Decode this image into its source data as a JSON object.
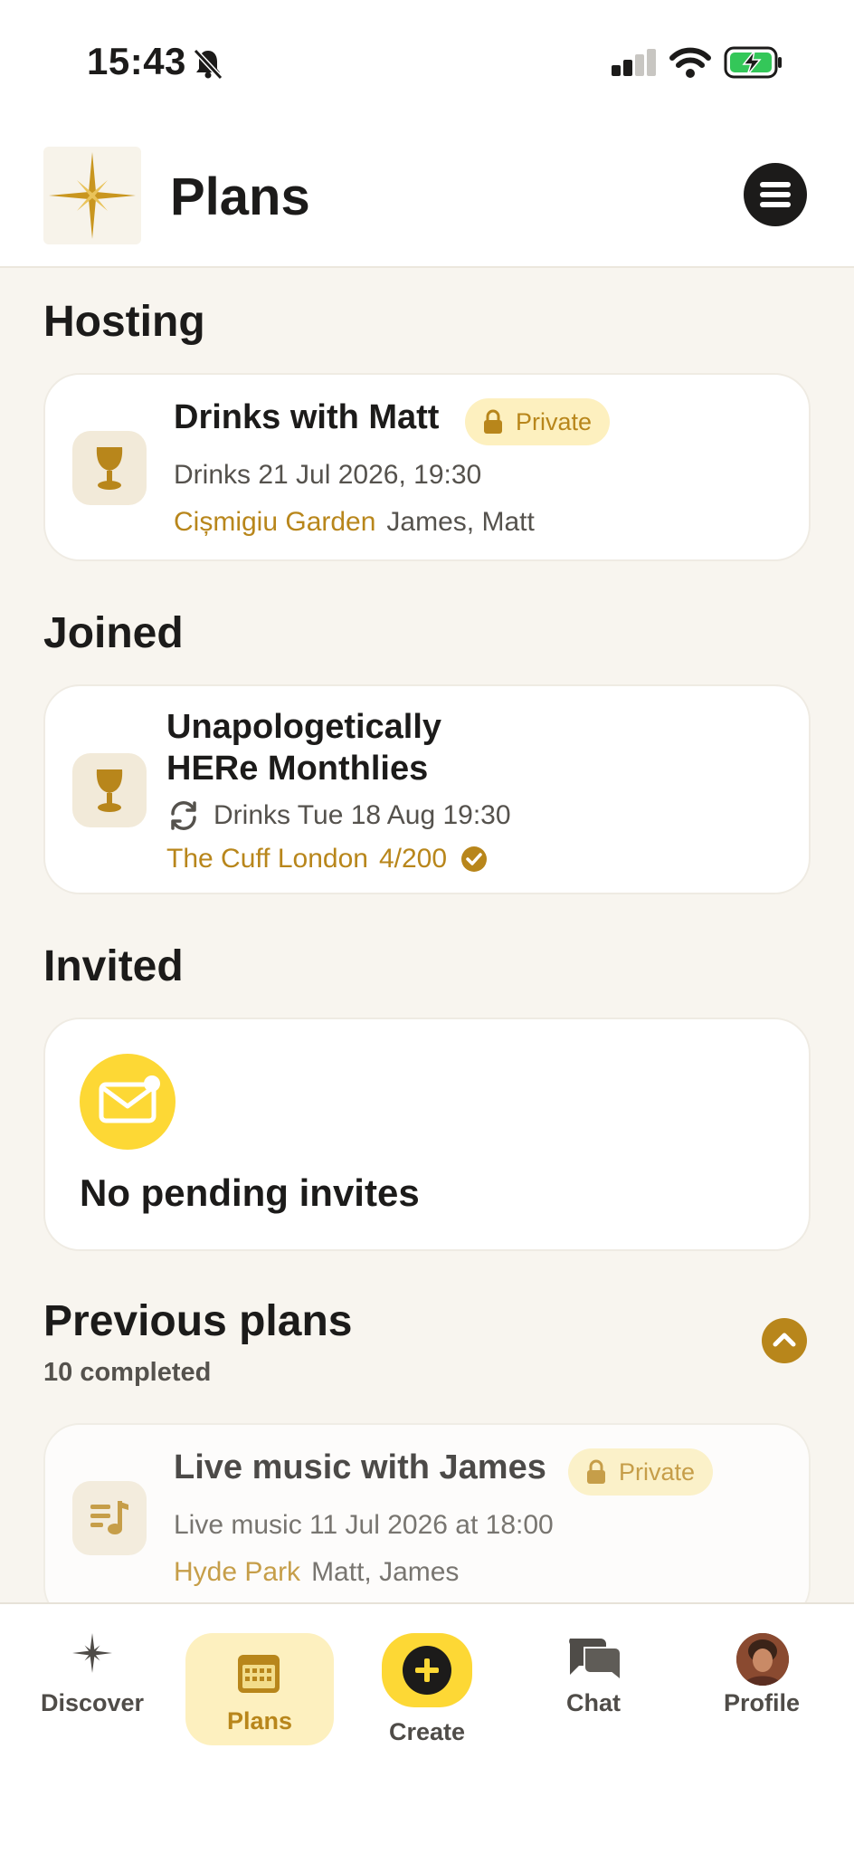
{
  "status_bar": {
    "time": "15:43"
  },
  "header": {
    "title": "Plans"
  },
  "hosting": {
    "title": "Hosting",
    "plan": {
      "title": "Drinks with Matt",
      "badge": "Private",
      "datetime": "Drinks 21 Jul 2026, 19:30",
      "venue": "Cișmigiu Garden",
      "people": "James, Matt"
    }
  },
  "joined": {
    "title": "Joined",
    "plan": {
      "title_line1": "Unapologetically",
      "title_line2": "HERe Monthlies",
      "datetime": "Drinks Tue 18 Aug 19:30",
      "venue": "The Cuff London",
      "count": "4/200"
    }
  },
  "invited": {
    "title": "Invited",
    "empty_text": "No pending invites"
  },
  "previous": {
    "title": "Previous plans",
    "subtitle": "10 completed",
    "plan": {
      "title": "Live music with James",
      "badge": "Private",
      "datetime": "Live music 11 Jul 2026 at 18:00",
      "venue": "Hyde Park",
      "people": "Matt, James"
    }
  },
  "nav": {
    "discover": "Discover",
    "plans": "Plans",
    "create": "Create",
    "chat": "Chat",
    "profile": "Profile"
  },
  "colors": {
    "accent": "#b8861b",
    "badge_bg": "#fdf0bf",
    "yellow": "#fdd835",
    "background": "#f8f5ef"
  }
}
